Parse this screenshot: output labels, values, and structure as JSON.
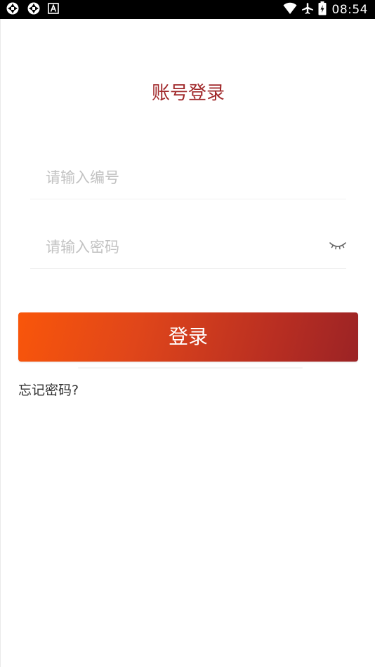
{
  "status_bar": {
    "time": "08:54",
    "left_icons": [
      "app-logo-icon",
      "app-logo-icon",
      "font-app-icon"
    ],
    "right_icons": [
      "wifi-icon",
      "airplane-icon",
      "battery-icon"
    ]
  },
  "login": {
    "title": "账号登录",
    "account_placeholder": "请输入编号",
    "account_value": "",
    "password_placeholder": "请输入密码",
    "password_value": "",
    "login_label": "登录",
    "forgot_label": "忘记密码?"
  },
  "colors": {
    "title": "#a0282a",
    "button_gradient_start": "#f9560a",
    "button_gradient_end": "#9b2325",
    "placeholder": "#c2c2c2"
  }
}
